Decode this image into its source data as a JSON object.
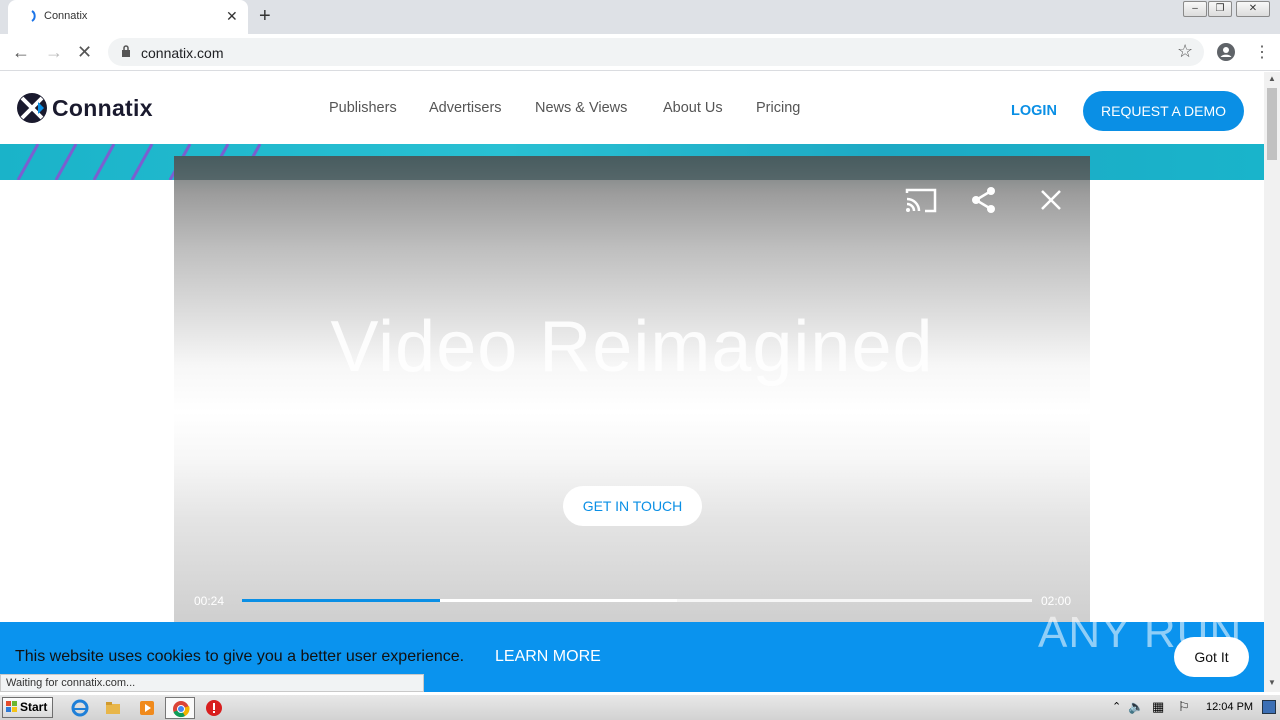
{
  "browser": {
    "tab_title": "Connatix",
    "url": "connatix.com",
    "status_text": "Waiting for connatix.com..."
  },
  "site": {
    "brand": "Connatix",
    "nav": [
      "Publishers",
      "Advertisers",
      "News & Views",
      "About Us",
      "Pricing"
    ],
    "login_label": "LOGIN",
    "demo_label": "REQUEST A DEMO"
  },
  "video": {
    "headline": "Video Reimagined",
    "cta_label": "GET IN TOUCH",
    "current_time": "00:24",
    "duration": "02:00",
    "played_fraction": 0.25,
    "buffered_fraction": 0.55,
    "icons": [
      "cast-icon",
      "share-icon",
      "close-icon"
    ]
  },
  "cookie": {
    "message": "This website uses cookies to give you a better user experience.",
    "learn_more": "LEARN MORE",
    "accept_label": "Got It"
  },
  "watermark": "ANY RUN",
  "taskbar": {
    "start_label": "Start",
    "clock": "12:04 PM"
  },
  "colors": {
    "accent": "#0a8fe5",
    "cookie_bar": "#0a93ee",
    "hero": "#1ab3c9"
  }
}
